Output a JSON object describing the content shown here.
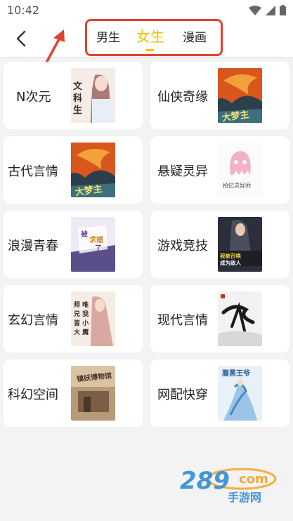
{
  "status": {
    "time": "10:42"
  },
  "tabs": {
    "male": "男生",
    "female": "女生",
    "comic": "漫画"
  },
  "categories": [
    {
      "label": "N次元",
      "cover_icon": "anime-girl-cover",
      "cover_text": "文科生"
    },
    {
      "label": "仙侠奇缘",
      "cover_icon": "fire-phoenix-cover",
      "cover_text": "大梦主"
    },
    {
      "label": "古代言情",
      "cover_icon": "fire-phoenix-cover",
      "cover_text": "大梦主"
    },
    {
      "label": "悬疑灵异",
      "cover_icon": "pink-ghost-cover",
      "cover_text": "拾忆灵异师"
    },
    {
      "label": "浪漫青春",
      "cover_icon": "lavender-title-cover",
      "cover_text": "被求婚了"
    },
    {
      "label": "游戏竞技",
      "cover_icon": "game-hero-cover",
      "cover_text": "我被召唤成为敌人"
    },
    {
      "label": "玄幻言情",
      "cover_icon": "ancient-lady-cover",
      "cover_text": "师兄唯我皆小大魔徒禁"
    },
    {
      "label": "现代言情",
      "cover_icon": "ink-calligraphy-cover",
      "cover_text": ""
    },
    {
      "label": "科幻空间",
      "cover_icon": "sepia-shop-cover",
      "cover_text": "镇妖博物馆"
    },
    {
      "label": "网配快穿",
      "cover_icon": "blue-dancer-cover",
      "cover_text": "腹黑王爷"
    }
  ],
  "watermark": {
    "brand": "289",
    "suffix": "com",
    "subtitle": "手游网"
  },
  "colors": {
    "accent": "#f2c100",
    "highlight_box": "#e0442f",
    "background": "#f3f3f3"
  }
}
